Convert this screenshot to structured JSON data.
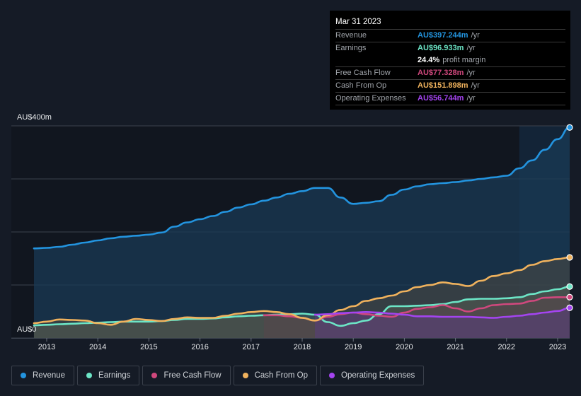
{
  "tooltip": {
    "date": "Mar 31 2023",
    "rows": [
      {
        "label": "Revenue",
        "value": "AU$397.244m",
        "unit": "/yr",
        "color": "#2394df"
      },
      {
        "label": "Earnings",
        "value": "AU$96.933m",
        "unit": "/yr",
        "color": "#6ce5c6"
      },
      {
        "label": "",
        "value": "24.4%",
        "unit": "profit margin",
        "color": "#ffffff"
      },
      {
        "label": "Free Cash Flow",
        "value": "AU$77.328m",
        "unit": "/yr",
        "color": "#d0487d"
      },
      {
        "label": "Cash From Op",
        "value": "AU$151.898m",
        "unit": "/yr",
        "color": "#f0b25d"
      },
      {
        "label": "Operating Expenses",
        "value": "AU$56.744m",
        "unit": "/yr",
        "color": "#a444f0"
      }
    ]
  },
  "legend": [
    {
      "label": "Revenue",
      "color": "#2394df"
    },
    {
      "label": "Earnings",
      "color": "#6ce5c6"
    },
    {
      "label": "Free Cash Flow",
      "color": "#d0487d"
    },
    {
      "label": "Cash From Op",
      "color": "#f0b25d"
    },
    {
      "label": "Operating Expenses",
      "color": "#a444f0"
    }
  ],
  "chart_data": {
    "type": "area",
    "title": "",
    "xlabel": "",
    "ylabel": "",
    "y_unit": "AU$",
    "ylim": [
      0,
      400
    ],
    "xlim": [
      2012.7,
      2023.25
    ],
    "y_tick_labels": [
      "AU$0",
      "AU$400m"
    ],
    "y_gridlines": [
      0,
      100,
      200,
      300,
      400
    ],
    "x_tick_labels": [
      "2013",
      "2014",
      "2015",
      "2016",
      "2017",
      "2018",
      "2019",
      "2020",
      "2021",
      "2022",
      "2023"
    ],
    "x_ticks": [
      2013,
      2014,
      2015,
      2016,
      2017,
      2018,
      2019,
      2020,
      2021,
      2022,
      2023
    ],
    "highlight_range": [
      2022.25,
      2023.25
    ],
    "legend_position": "bottom",
    "series": [
      {
        "name": "Revenue",
        "color": "#2394df",
        "x": [
          2012.75,
          2013.0,
          2013.25,
          2013.5,
          2013.75,
          2014.0,
          2014.25,
          2014.5,
          2014.75,
          2015.0,
          2015.25,
          2015.5,
          2015.75,
          2016.0,
          2016.25,
          2016.5,
          2016.75,
          2017.0,
          2017.25,
          2017.5,
          2017.75,
          2018.0,
          2018.25,
          2018.5,
          2018.75,
          2019.0,
          2019.25,
          2019.5,
          2019.75,
          2020.0,
          2020.25,
          2020.5,
          2020.75,
          2021.0,
          2021.25,
          2021.5,
          2021.75,
          2022.0,
          2022.25,
          2022.5,
          2022.75,
          2023.0,
          2023.25
        ],
        "values": [
          169,
          170,
          172,
          176,
          180,
          184,
          188,
          191,
          193,
          195,
          199,
          210,
          218,
          224,
          230,
          238,
          246,
          252,
          259,
          265,
          272,
          277,
          283,
          283,
          265,
          253,
          255,
          258,
          270,
          280,
          286,
          290,
          292,
          294,
          297,
          300,
          303,
          306,
          320,
          335,
          355,
          375,
          397
        ]
      },
      {
        "name": "Earnings",
        "color": "#6ce5c6",
        "x": [
          2012.75,
          2013.0,
          2013.25,
          2013.5,
          2013.75,
          2014.0,
          2014.25,
          2014.5,
          2014.75,
          2015.0,
          2015.25,
          2015.5,
          2015.75,
          2016.0,
          2016.25,
          2016.5,
          2016.75,
          2017.0,
          2017.25,
          2017.5,
          2017.75,
          2018.0,
          2018.25,
          2018.5,
          2018.75,
          2019.0,
          2019.25,
          2019.5,
          2019.75,
          2020.0,
          2020.25,
          2020.5,
          2020.75,
          2021.0,
          2021.25,
          2021.5,
          2021.75,
          2022.0,
          2022.25,
          2022.5,
          2022.75,
          2023.0,
          2023.25
        ],
        "values": [
          24,
          25,
          26,
          27,
          28,
          29,
          30,
          31,
          31,
          31,
          32,
          34,
          36,
          36,
          37,
          39,
          41,
          42,
          43,
          44,
          45,
          46,
          44,
          30,
          23,
          28,
          33,
          45,
          60,
          60,
          61,
          62,
          64,
          68,
          73,
          74,
          74,
          75,
          77,
          83,
          88,
          92,
          97
        ]
      },
      {
        "name": "Free Cash Flow",
        "color": "#d0487d",
        "x": [
          2017.25,
          2017.5,
          2017.75,
          2018.0,
          2018.25,
          2018.5,
          2018.75,
          2019.0,
          2019.25,
          2019.5,
          2019.75,
          2020.0,
          2020.25,
          2020.5,
          2020.75,
          2021.0,
          2021.25,
          2021.5,
          2021.75,
          2022.0,
          2022.25,
          2022.5,
          2022.75,
          2023.0,
          2023.25
        ],
        "values": [
          43,
          43,
          41,
          38,
          33,
          40,
          45,
          48,
          45,
          42,
          40,
          48,
          55,
          58,
          62,
          56,
          50,
          56,
          62,
          64,
          65,
          70,
          76,
          77,
          77
        ]
      },
      {
        "name": "Cash From Op",
        "color": "#f0b25d",
        "x": [
          2012.75,
          2013.0,
          2013.25,
          2013.5,
          2013.75,
          2014.0,
          2014.25,
          2014.5,
          2014.75,
          2015.0,
          2015.25,
          2015.5,
          2015.75,
          2016.0,
          2016.25,
          2016.5,
          2016.75,
          2017.0,
          2017.25,
          2017.5,
          2017.75,
          2018.0,
          2018.25,
          2018.5,
          2018.75,
          2019.0,
          2019.25,
          2019.5,
          2019.75,
          2020.0,
          2020.25,
          2020.5,
          2020.75,
          2021.0,
          2021.25,
          2021.5,
          2021.75,
          2022.0,
          2022.25,
          2022.5,
          2022.75,
          2023.0,
          2023.25
        ],
        "values": [
          28,
          31,
          35,
          34,
          33,
          28,
          25,
          31,
          36,
          34,
          32,
          36,
          39,
          38,
          38,
          42,
          46,
          49,
          51,
          49,
          45,
          38,
          33,
          43,
          53,
          60,
          70,
          75,
          80,
          88,
          96,
          100,
          105,
          102,
          98,
          108,
          117,
          122,
          128,
          138,
          145,
          149,
          152
        ]
      },
      {
        "name": "Operating Expenses",
        "color": "#a444f0",
        "x": [
          2018.25,
          2018.5,
          2018.75,
          2019.0,
          2019.25,
          2019.5,
          2019.75,
          2020.0,
          2020.25,
          2020.5,
          2020.75,
          2021.0,
          2021.25,
          2021.5,
          2021.75,
          2022.0,
          2022.25,
          2022.5,
          2022.75,
          2023.0,
          2023.25
        ],
        "values": [
          44,
          45,
          47,
          48,
          49,
          48,
          46,
          44,
          41,
          41,
          40,
          40,
          40,
          39,
          38,
          40,
          42,
          45,
          48,
          51,
          57
        ]
      }
    ]
  }
}
